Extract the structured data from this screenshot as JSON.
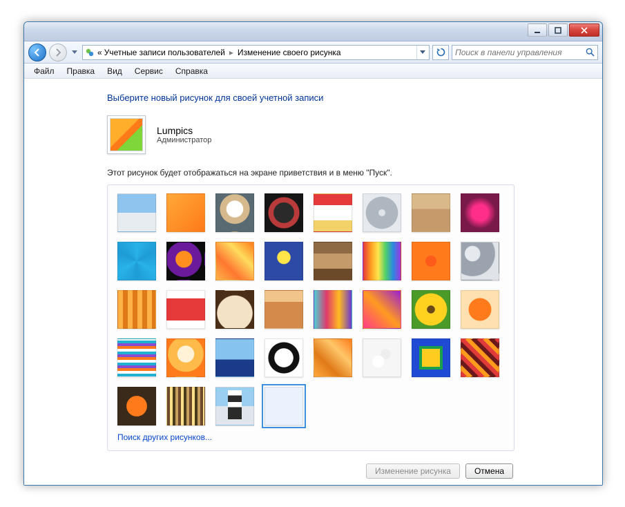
{
  "titlebar": {},
  "nav": {
    "breadcrumb_prefix": "«",
    "crumb1": "Учетные записи пользователей",
    "crumb2": "Изменение своего рисунка"
  },
  "search": {
    "placeholder": "Поиск в панели управления"
  },
  "menu": {
    "file": "Файл",
    "edit": "Правка",
    "view": "Вид",
    "tools": "Сервис",
    "help": "Справка"
  },
  "main": {
    "heading": "Выберите новый рисунок для своей учетной записи",
    "username": "Lumpics",
    "role": "Администратор",
    "description": "Этот рисунок будет отображаться на экране приветствия и в меню \"Пуск\".",
    "browse_link": "Поиск других рисунков...",
    "selected_index": 35,
    "pictures": [
      {
        "name": "rollercoaster"
      },
      {
        "name": "goldfish"
      },
      {
        "name": "robot-toy"
      },
      {
        "name": "vinyl-record"
      },
      {
        "name": "maneki-neko"
      },
      {
        "name": "gyroscope"
      },
      {
        "name": "kitten"
      },
      {
        "name": "pink-flower"
      },
      {
        "name": "pinwheel"
      },
      {
        "name": "bowling-ball"
      },
      {
        "name": "orange-pattern"
      },
      {
        "name": "yellow-leaf"
      },
      {
        "name": "dog"
      },
      {
        "name": "crayons"
      },
      {
        "name": "starburst"
      },
      {
        "name": "jacks"
      },
      {
        "name": "wood-stairs"
      },
      {
        "name": "origami-crane"
      },
      {
        "name": "guitar"
      },
      {
        "name": "pomeranian"
      },
      {
        "name": "toy-robot"
      },
      {
        "name": "fabric"
      },
      {
        "name": "sunflower"
      },
      {
        "name": "orange-slice"
      },
      {
        "name": "hot-air-balloon"
      },
      {
        "name": "matryoshka"
      },
      {
        "name": "sailboat"
      },
      {
        "name": "soccer-ball"
      },
      {
        "name": "tiles"
      },
      {
        "name": "marbles"
      },
      {
        "name": "window-frame"
      },
      {
        "name": "textile"
      },
      {
        "name": "butterfly"
      },
      {
        "name": "books"
      },
      {
        "name": "lighthouse"
      },
      {
        "name": "gerbera-flower"
      }
    ]
  },
  "buttons": {
    "change": "Изменение рисунка",
    "cancel": "Отмена"
  }
}
